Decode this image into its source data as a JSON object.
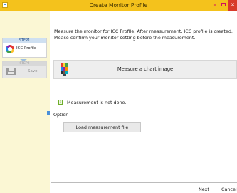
{
  "window": {
    "title": "Create Monitor Profile",
    "minimize_glyph": "–",
    "close_glyph": "✕",
    "accent_color": "#f4c21c"
  },
  "steps": [
    {
      "header": "STEP1",
      "label": "ICC Profile",
      "state": "active"
    },
    {
      "header": "STEP2",
      "label": "Save",
      "state": "disabled"
    }
  ],
  "main": {
    "description": "Measure the monitor for ICC Profile. After measurement, ICC profile is created. Please confirm your monitor setting before the measurement.",
    "measure_button": "Measure a chart image",
    "status_text": "Measurement is not done.",
    "option_label": "Option",
    "load_button": "Load measurement file"
  },
  "footer": {
    "next_label": "Next",
    "cancel_label": "Cancel"
  },
  "icons": [
    "app-icon",
    "icc-profile-icon",
    "save-icon",
    "chart-icon",
    "info-icon"
  ]
}
